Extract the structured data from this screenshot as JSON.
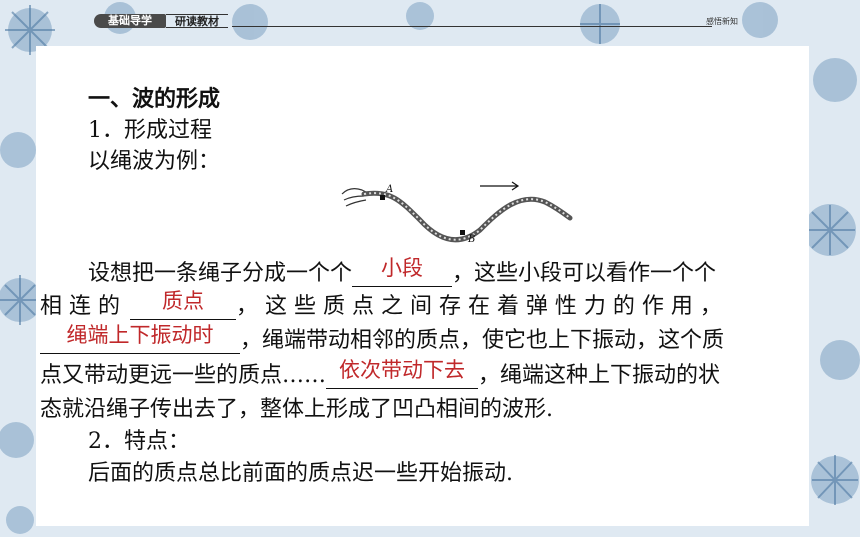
{
  "header": {
    "tag_dark": "基础导学",
    "tag_light": "研读教材",
    "right_note": "感悟新知"
  },
  "section": {
    "title": "一、波的形成",
    "sub1": "1．形成过程",
    "example": "以绳波为例：",
    "figure_labels": {
      "a": "A",
      "b": "B"
    },
    "para": {
      "l1_pre": "设想把一条绳子分成一个个",
      "l1_ans": "小段",
      "l1_post": "，这些小段可以看作一个个",
      "l2_pre": "相 连 的",
      "l2_ans": "质点",
      "l2_post": "， 这 些 质 点 之 间 存 在 着 弹 性 力 的 作 用 ，",
      "l3_ans": "绳端上下振动时",
      "l3_post": "，绳端带动相邻的质点，使它也上下振动，这个质",
      "l4_pre": "点又带动更远一些的质点……",
      "l4_ans": "依次带动下去",
      "l4_post": "，绳端这种上下振动的状",
      "l5": "态就沿绳子传出去了，整体上形成了凹凸相间的波形."
    },
    "sub2": "2．特点：",
    "feature": "后面的质点总比前面的质点迟一些开始振动."
  }
}
